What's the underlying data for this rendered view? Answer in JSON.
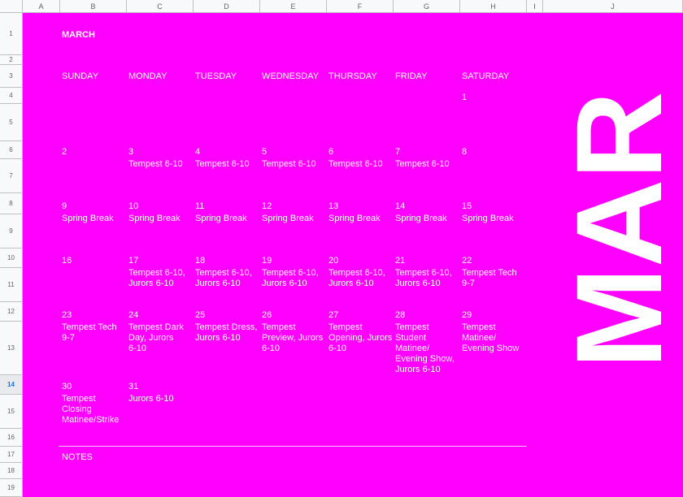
{
  "columns": [
    "A",
    "B",
    "C",
    "D",
    "E",
    "F",
    "G",
    "H",
    "I",
    "J"
  ],
  "rows": [
    "1",
    "2",
    "3",
    "4",
    "5",
    "6",
    "7",
    "8",
    "9",
    "10",
    "11",
    "12",
    "13",
    "14",
    "15",
    "16",
    "17",
    "18",
    "19"
  ],
  "selected_row": "14",
  "title": "MARCH",
  "big_label": "MAR",
  "days": [
    "SUNDAY",
    "MONDAY",
    "TUESDAY",
    "WEDNESDAY",
    "THURSDAY",
    "FRIDAY",
    "SATURDAY"
  ],
  "weeks": [
    [
      {
        "n": "",
        "e": ""
      },
      {
        "n": "",
        "e": ""
      },
      {
        "n": "",
        "e": ""
      },
      {
        "n": "",
        "e": ""
      },
      {
        "n": "",
        "e": ""
      },
      {
        "n": "",
        "e": ""
      },
      {
        "n": "1",
        "e": ""
      }
    ],
    [
      {
        "n": "2",
        "e": ""
      },
      {
        "n": "3",
        "e": "Tempest 6-10"
      },
      {
        "n": "4",
        "e": "Tempest 6-10"
      },
      {
        "n": "5",
        "e": "Tempest 6-10"
      },
      {
        "n": "6",
        "e": "Tempest 6-10"
      },
      {
        "n": "7",
        "e": "Tempest 6-10"
      },
      {
        "n": "8",
        "e": ""
      }
    ],
    [
      {
        "n": "9",
        "e": "Spring Break"
      },
      {
        "n": "10",
        "e": "Spring Break"
      },
      {
        "n": "11",
        "e": "Spring Break"
      },
      {
        "n": "12",
        "e": "Spring Break"
      },
      {
        "n": "13",
        "e": "Spring Break"
      },
      {
        "n": "14",
        "e": "Spring Break"
      },
      {
        "n": "15",
        "e": "Spring Break"
      }
    ],
    [
      {
        "n": "16",
        "e": ""
      },
      {
        "n": "17",
        "e": "Tempest 6-10,\nJurors 6-10"
      },
      {
        "n": "18",
        "e": "Tempest 6-10,\nJurors 6-10"
      },
      {
        "n": "19",
        "e": "Tempest 6-10,\nJurors 6-10"
      },
      {
        "n": "20",
        "e": "Tempest 6-10,\nJurors 6-10"
      },
      {
        "n": "21",
        "e": "Tempest 6-10,\nJurors 6-10"
      },
      {
        "n": "22",
        "e": "Tempest Tech\n9-7"
      }
    ],
    [
      {
        "n": "23",
        "e": "Tempest Tech\n9-7"
      },
      {
        "n": "24",
        "e": "Tempest Dark\nDay, Jurors\n6-10"
      },
      {
        "n": "25",
        "e": "Tempest Dress,\nJurors 6-10"
      },
      {
        "n": "26",
        "e": "Tempest\nPreview, Jurors\n6-10"
      },
      {
        "n": "27",
        "e": "Tempest\nOpening, Jurors\n6-10"
      },
      {
        "n": "28",
        "e": "Tempest\nStudent\nMatinee/\nEvening Show,\nJurors 6-10"
      },
      {
        "n": "29",
        "e": "Tempest\nMatinee/\nEvening Show"
      }
    ],
    [
      {
        "n": "30",
        "e": "Tempest\nClosing\nMatinee/Strike"
      },
      {
        "n": "31",
        "e": "Jurors 6-10"
      },
      {
        "n": "",
        "e": ""
      },
      {
        "n": "",
        "e": ""
      },
      {
        "n": "",
        "e": ""
      },
      {
        "n": "",
        "e": ""
      },
      {
        "n": "",
        "e": ""
      }
    ]
  ],
  "notes_label": "NOTES",
  "colors": {
    "background": "#ff00ff",
    "text": "#ffffff"
  }
}
